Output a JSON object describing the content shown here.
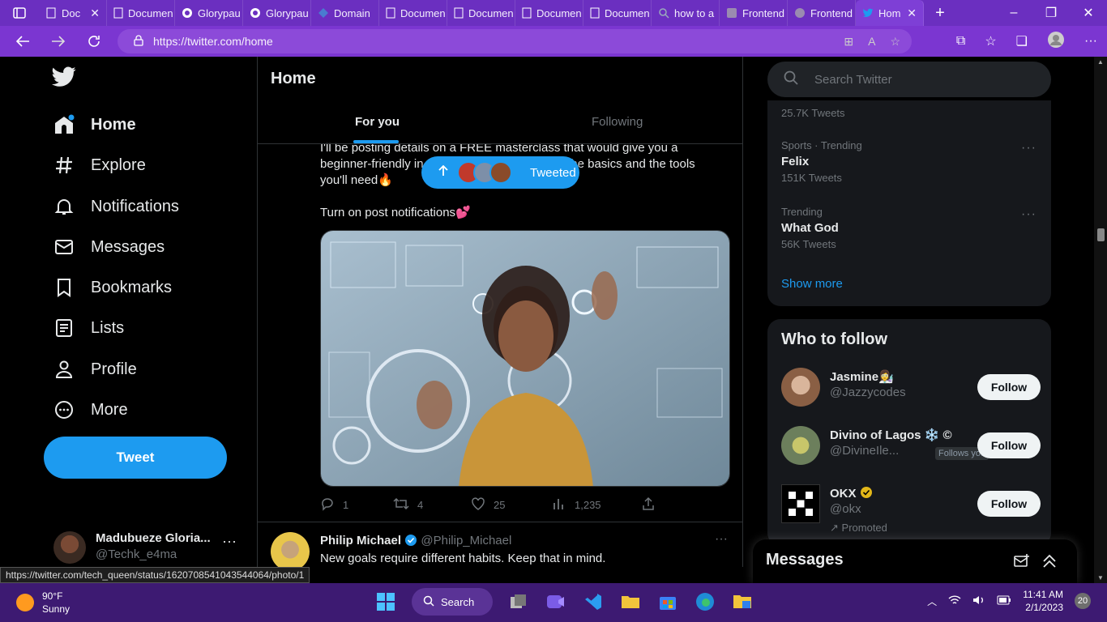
{
  "browser": {
    "tabs": [
      {
        "label": "Doc",
        "icon": "document-icon"
      },
      {
        "label": "Documen",
        "icon": "document-icon"
      },
      {
        "label": "Glorypau",
        "icon": "github-icon"
      },
      {
        "label": "Glorypau",
        "icon": "github-icon"
      },
      {
        "label": "Domain",
        "icon": "domain-icon"
      },
      {
        "label": "Documen",
        "icon": "document-icon"
      },
      {
        "label": "Documen",
        "icon": "document-icon"
      },
      {
        "label": "Documen",
        "icon": "document-icon"
      },
      {
        "label": "Documen",
        "icon": "document-icon"
      },
      {
        "label": "how to a",
        "icon": "search-icon"
      },
      {
        "label": "Frontend",
        "icon": "frontend-icon"
      },
      {
        "label": "Frontend",
        "icon": "frontend-icon"
      },
      {
        "label": "Hom",
        "icon": "twitter-icon"
      }
    ],
    "url": "https://twitter.com/home",
    "status_url": "https://twitter.com/tech_queen/status/1620708541043544064/photo/1"
  },
  "nav": {
    "items": [
      {
        "label": "Home",
        "icon": "home-icon"
      },
      {
        "label": "Explore",
        "icon": "hashtag-icon"
      },
      {
        "label": "Notifications",
        "icon": "bell-icon"
      },
      {
        "label": "Messages",
        "icon": "envelope-icon"
      },
      {
        "label": "Bookmarks",
        "icon": "bookmark-icon"
      },
      {
        "label": "Lists",
        "icon": "list-icon"
      },
      {
        "label": "Profile",
        "icon": "person-icon"
      },
      {
        "label": "More",
        "icon": "more-circle-icon"
      }
    ],
    "tweet_button": "Tweet",
    "account": {
      "name": "Madubueze Gloria...",
      "handle": "@Techk_e4ma"
    }
  },
  "main": {
    "title": "Home",
    "tabs": [
      "For you",
      "Following"
    ],
    "tweeted_pill": "Tweeted",
    "tweet": {
      "line1": "I'll be posting details on a FREE masterclass that would give you a",
      "line2_a": "beginner-friendly in",
      "line2_b": "l the basics and the tools",
      "line3": "you'll need🔥",
      "line4": "Turn on post notifications💕",
      "stats": {
        "replies": "1",
        "retweets": "4",
        "likes": "25",
        "views": "1,235"
      }
    },
    "next_tweet": {
      "name": "Philip Michael",
      "handle": "@Philip_Michael",
      "text": "New goals require different habits. Keep that in mind."
    }
  },
  "sidebar": {
    "search_placeholder": "Search Twitter",
    "trends": [
      {
        "meta": "",
        "name": "",
        "count": "25.7K Tweets"
      },
      {
        "meta": "Sports · Trending",
        "name": "Felix",
        "count": "151K Tweets"
      },
      {
        "meta": "Trending",
        "name": "What God",
        "count": "56K Tweets"
      }
    ],
    "show_more": "Show more",
    "who_to_follow": {
      "title": "Who to follow",
      "users": [
        {
          "name": "Jasmine👩‍🔬",
          "handle": "@Jazzycodes",
          "button": "Follow"
        },
        {
          "name": "Divino of Lagos ❄️ ©",
          "handle": "@DivineIle...",
          "extra": "Follows you",
          "button": "Follow"
        },
        {
          "name": "OKX",
          "handle": "@okx",
          "extra": "Promoted",
          "button": "Follow"
        }
      ]
    },
    "messages_title": "Messages"
  },
  "taskbar": {
    "weather": {
      "temp": "90°F",
      "cond": "Sunny"
    },
    "search_label": "Search",
    "time": "11:41 AM",
    "date": "2/1/2023",
    "notif_count": "20"
  },
  "colors": {
    "accent": "#1d9bf0",
    "browser": "#7b36d1",
    "taskbar": "#3d1a72"
  }
}
